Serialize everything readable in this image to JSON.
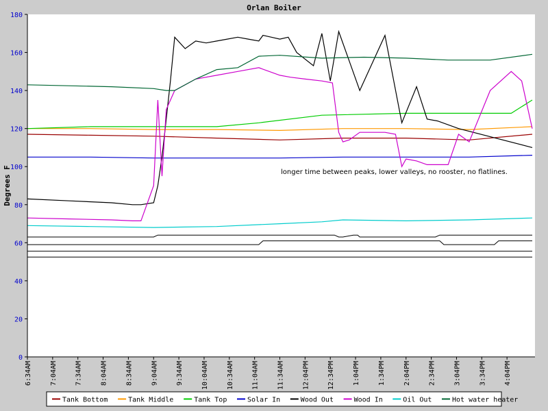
{
  "chart_data": {
    "type": "line",
    "title": "Orlan Boiler",
    "ylabel": "Degrees F",
    "xlabel": "",
    "ylim": [
      0,
      180
    ],
    "y_ticks": [
      0,
      20,
      40,
      60,
      80,
      100,
      120,
      140,
      160,
      180
    ],
    "x_range": [
      0,
      240
    ],
    "x_tick_labels": [
      "6:34AM",
      "7:04AM",
      "7:34AM",
      "8:04AM",
      "8:34AM",
      "9:04AM",
      "9:34AM",
      "10:04AM",
      "10:34AM",
      "11:04AM",
      "11:34AM",
      "12:04PM",
      "12:34PM",
      "1:04PM",
      "1:34PM",
      "2:04PM",
      "2:34PM",
      "3:04PM",
      "3:34PM",
      "4:04PM"
    ],
    "grid": false,
    "legend_position": "bottom",
    "annotation": "longer time between peaks, lower valleys, no rooster, no flatlines.",
    "series": [
      {
        "name": "Tank Bottom",
        "color": "#990000",
        "x": [
          0,
          30,
          60,
          90,
          120,
          150,
          180,
          210,
          240
        ],
        "y": [
          117,
          116.5,
          116,
          115,
          114,
          115,
          115,
          114,
          117
        ]
      },
      {
        "name": "Tank Middle",
        "color": "#ff9900",
        "x": [
          0,
          30,
          60,
          90,
          120,
          150,
          180,
          210,
          240
        ],
        "y": [
          120,
          120,
          119.5,
          119.5,
          119,
          120,
          120,
          119.5,
          121
        ]
      },
      {
        "name": "Tank Top",
        "color": "#00cc00",
        "x": [
          0,
          30,
          60,
          90,
          110,
          140,
          180,
          200,
          230,
          240
        ],
        "y": [
          120,
          121,
          121,
          121,
          123,
          127,
          128,
          128,
          128,
          135
        ]
      },
      {
        "name": "Solar In",
        "color": "#0000cc",
        "x": [
          0,
          30,
          60,
          90,
          120,
          150,
          180,
          210,
          240
        ],
        "y": [
          105,
          105,
          104.5,
          104.5,
          104.5,
          105,
          105,
          105,
          106
        ]
      },
      {
        "name": "Wood Out",
        "color": "#000000",
        "x": [
          0,
          20,
          40,
          50,
          54,
          60,
          62,
          64,
          66,
          68,
          70,
          75,
          80,
          85,
          90,
          95,
          100,
          105,
          110,
          112,
          116,
          120,
          124,
          128,
          136,
          140,
          144,
          148,
          158,
          170,
          178,
          185,
          190,
          195,
          205,
          240
        ],
        "y": [
          83,
          82,
          81,
          80,
          80,
          81,
          90,
          105,
          125,
          145,
          168,
          162,
          166,
          165,
          166,
          167,
          168,
          167,
          166,
          169,
          168,
          167,
          168,
          160,
          153,
          170,
          145,
          171,
          140,
          169,
          123,
          142,
          125,
          124,
          120,
          110
        ]
      },
      {
        "name": "Wood In",
        "color": "#cc00cc",
        "x": [
          0,
          20,
          40,
          50,
          54,
          60,
          62,
          64,
          66,
          70,
          80,
          90,
          100,
          110,
          120,
          125,
          132,
          140,
          145,
          148,
          150,
          153,
          158,
          170,
          175,
          178,
          180,
          185,
          190,
          200,
          205,
          210,
          220,
          230,
          235,
          240
        ],
        "y": [
          73,
          72.5,
          72,
          71.5,
          71.5,
          90,
          135,
          95,
          130,
          140,
          146,
          148,
          150,
          152,
          148,
          147,
          146,
          145,
          144,
          118,
          113,
          114,
          118,
          118,
          117,
          100,
          104,
          103,
          101,
          101,
          117,
          113,
          140,
          150,
          145,
          120
        ]
      },
      {
        "name": "Oil Out",
        "color": "#00cccc",
        "x": [
          0,
          30,
          60,
          90,
          120,
          140,
          150,
          180,
          210,
          240
        ],
        "y": [
          69,
          68.5,
          68,
          68.5,
          70,
          71,
          72,
          71.5,
          72,
          73
        ]
      },
      {
        "name": "Hot water heater",
        "color": "#006633",
        "x": [
          0,
          40,
          60,
          66,
          70,
          80,
          90,
          100,
          110,
          120,
          140,
          160,
          180,
          200,
          220,
          240
        ],
        "y": [
          143,
          142,
          141,
          140,
          140,
          146,
          151,
          152,
          158,
          158.5,
          157,
          157.5,
          157,
          156,
          156,
          159
        ]
      }
    ],
    "step_lines": [
      {
        "x": [
          0,
          60,
          62,
          146,
          148,
          150,
          155,
          157,
          158,
          194,
          196,
          240
        ],
        "y": [
          63,
          63,
          64,
          64,
          63,
          63,
          64,
          64,
          63,
          63,
          64,
          64
        ]
      },
      {
        "x": [
          0,
          110,
          112,
          196,
          198,
          222,
          224,
          240
        ],
        "y": [
          59,
          59,
          61,
          61,
          59,
          59,
          61,
          61
        ]
      },
      {
        "x": [
          0,
          240
        ],
        "y": [
          55.5,
          55.5
        ]
      },
      {
        "x": [
          0,
          240
        ],
        "y": [
          52.5,
          52.5
        ]
      }
    ]
  }
}
